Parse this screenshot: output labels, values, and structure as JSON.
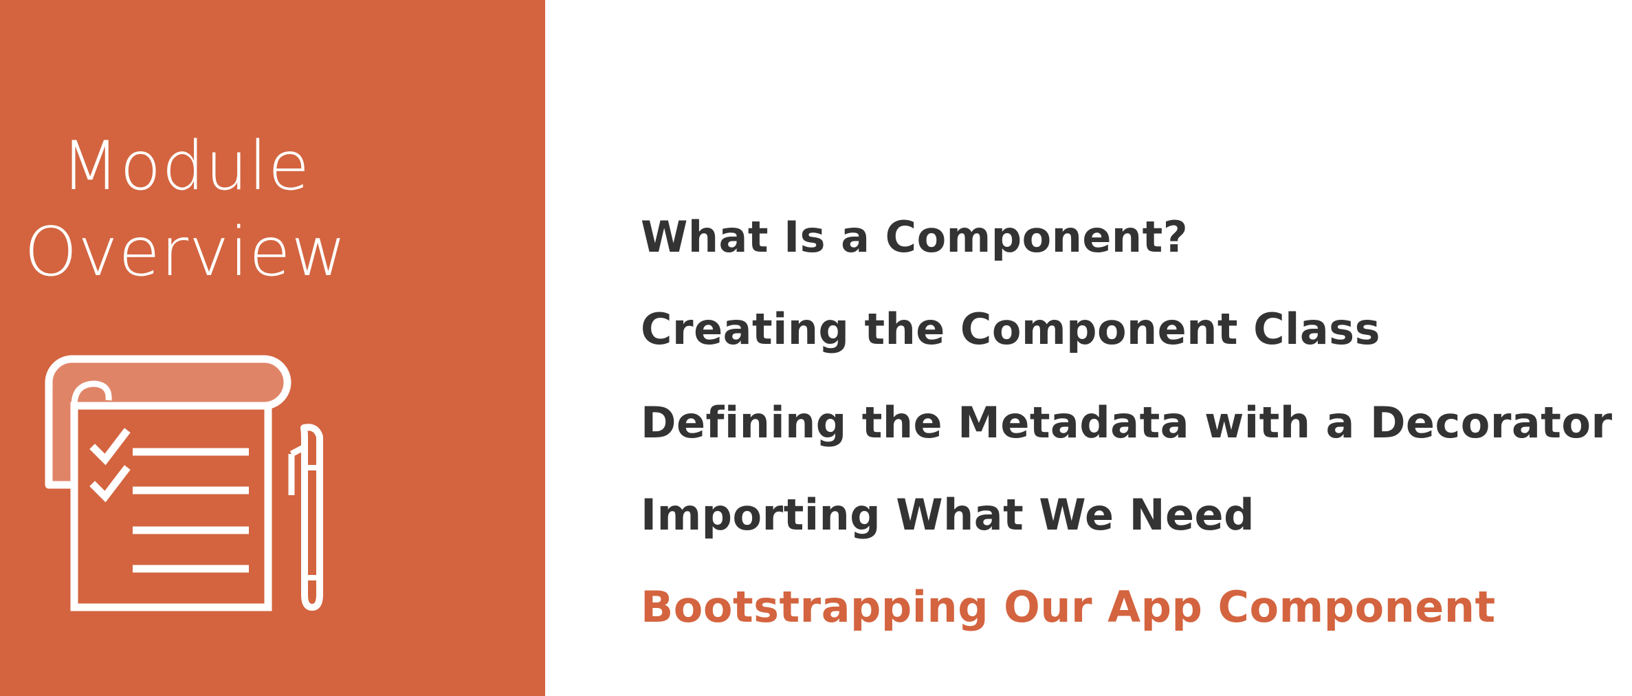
{
  "left_panel": {
    "title_line1": "Module",
    "title_line2": "Overview",
    "icon": "notepad-checklist-pen-icon",
    "background_color": "#D3643F"
  },
  "topics": [
    {
      "label": "What Is a Component?",
      "active": false
    },
    {
      "label": "Creating the Component Class",
      "active": false
    },
    {
      "label": "Defining the Metadata with a Decorator",
      "active": false
    },
    {
      "label": "Importing What We Need",
      "active": false
    },
    {
      "label": "Bootstrapping Our App Component",
      "active": true
    }
  ],
  "colors": {
    "accent": "#D3643F",
    "text": "#333333",
    "background": "#FFFFFF"
  }
}
